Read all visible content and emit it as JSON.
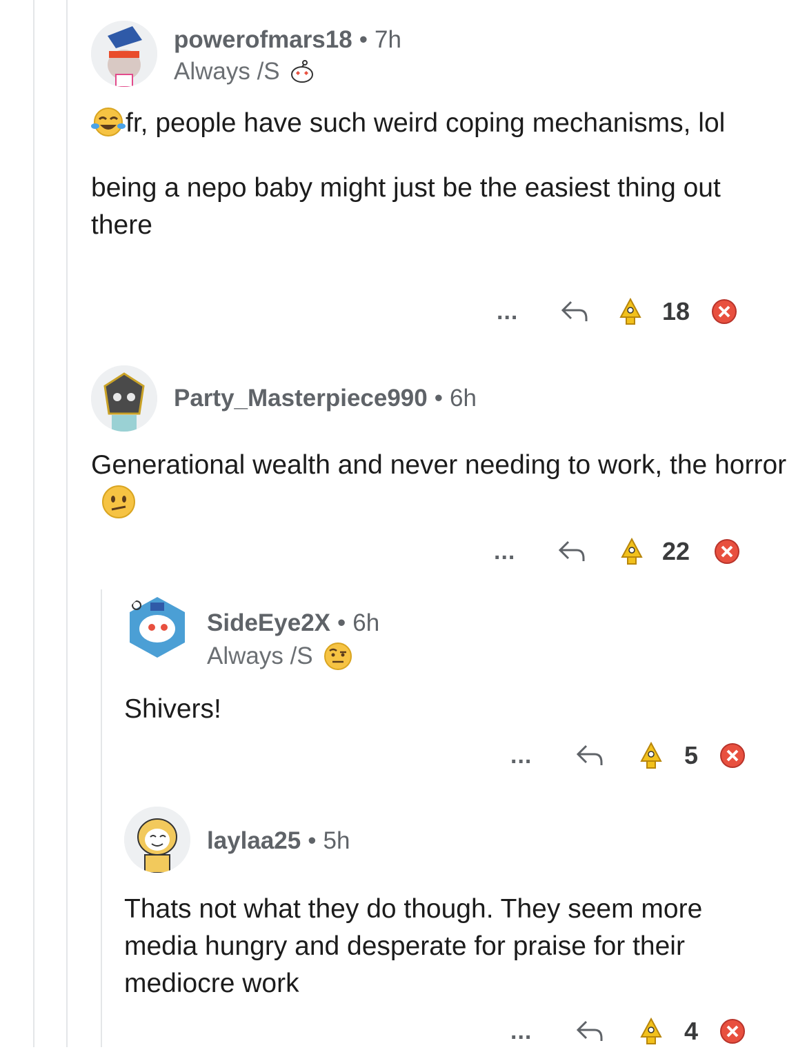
{
  "comments": [
    {
      "username": "powerofmars18",
      "time": "7h",
      "flair": "Always /S",
      "body": [
        "fr, people have such weird coping mechanisms, lol",
        "being a nepo baby might just be the easiest thing out there"
      ],
      "votes": "18",
      "more": "..."
    },
    {
      "username": "Party_Masterpiece990",
      "time": "6h",
      "body": [
        "Generational wealth and never needing to work, the horror"
      ],
      "votes": "22",
      "more": "..."
    },
    {
      "username": "SideEye2X",
      "time": "6h",
      "flair": "Always /S",
      "body": [
        "Shivers!"
      ],
      "votes": "5",
      "more": "..."
    },
    {
      "username": "laylaa25",
      "time": "5h",
      "body": [
        "Thats not what they do though. They seem more media hungry and desperate for praise for their mediocre work"
      ],
      "votes": "4",
      "more": "..."
    }
  ],
  "separator": "•",
  "icons": {
    "reply": "reply-arrow-icon",
    "upvote": "upvote-award-icon",
    "downvote": "downvote-x-icon",
    "emoji_laugh": "tears-of-joy-emoji",
    "emoji_confused": "confused-face-emoji",
    "emoji_raised_brow": "raised-eyebrow-emoji",
    "flair_snoo": "heart-eyes-snoo-icon"
  },
  "colors": {
    "username": "#5f6368",
    "body": "#1c1c1c",
    "thread_line": "#e4e6e8",
    "downvote": "#e8503f",
    "upvote": "#f2c11c"
  }
}
